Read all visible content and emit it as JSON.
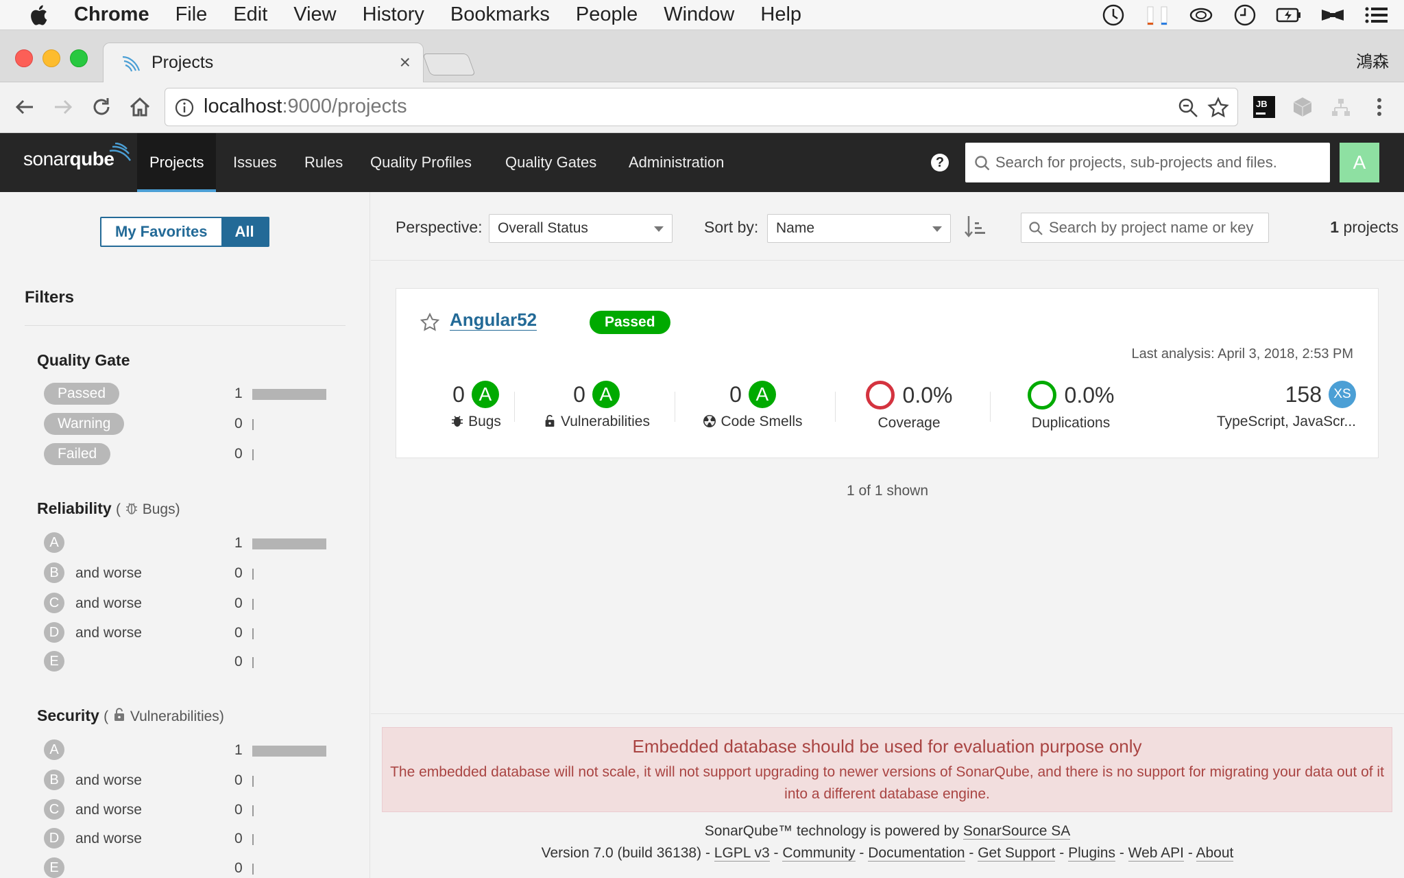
{
  "menubar": {
    "app": "Chrome",
    "items": [
      "File",
      "Edit",
      "View",
      "History",
      "Bookmarks",
      "People",
      "Window",
      "Help"
    ]
  },
  "browser": {
    "tab_title": "Projects",
    "tab_close": "×",
    "profile": "鴻森",
    "url_host": "localhost",
    "url_path": ":9000/projects"
  },
  "sq": {
    "logo_a": "sonar",
    "logo_b": "qube",
    "nav": [
      "Projects",
      "Issues",
      "Rules",
      "Quality Profiles",
      "Quality Gates",
      "Administration"
    ],
    "help": "?",
    "search_placeholder": "Search for projects, sub-projects and files.",
    "avatar": "A"
  },
  "sidebar": {
    "fav": "My Favorites",
    "all": "All",
    "filters": "Filters",
    "quality_gate": {
      "title": "Quality Gate",
      "items": [
        {
          "label": "Passed",
          "count": "1",
          "frac": 1
        },
        {
          "label": "Warning",
          "count": "0",
          "frac": 0
        },
        {
          "label": "Failed",
          "count": "0",
          "frac": 0
        }
      ]
    },
    "reliability": {
      "title": "Reliability",
      "open": "(",
      "sub": "Bugs",
      "close": ")"
    },
    "security": {
      "title": "Security",
      "open": "(",
      "sub": "Vulnerabilities",
      "close": ")"
    },
    "rating_rows": [
      {
        "grade": "A",
        "suffix": "",
        "count": "1",
        "frac": 1
      },
      {
        "grade": "B",
        "suffix": "and worse",
        "count": "0",
        "frac": 0
      },
      {
        "grade": "C",
        "suffix": "and worse",
        "count": "0",
        "frac": 0
      },
      {
        "grade": "D",
        "suffix": "and worse",
        "count": "0",
        "frac": 0
      },
      {
        "grade": "E",
        "suffix": "",
        "count": "0",
        "frac": 0
      }
    ]
  },
  "main": {
    "perspective_label": "Perspective:",
    "perspective_value": "Overall Status",
    "sort_label": "Sort by:",
    "sort_value": "Name",
    "search_placeholder": "Search by project name or key",
    "count": "1",
    "count_suffix": "projects",
    "shown": "1 of 1 shown"
  },
  "project": {
    "name": "Angular52",
    "gate": "Passed",
    "last_analysis": "Last analysis: April 3, 2018, 2:53 PM",
    "bugs": {
      "value": "0",
      "grade": "A",
      "label": "Bugs"
    },
    "vulns": {
      "value": "0",
      "grade": "A",
      "label": "Vulnerabilities"
    },
    "smells": {
      "value": "0",
      "grade": "A",
      "label": "Code Smells"
    },
    "coverage": {
      "value": "0.0%",
      "label": "Coverage",
      "color": "#d4333f"
    },
    "dups": {
      "value": "0.0%",
      "label": "Duplications",
      "color": "#00aa00"
    },
    "size": {
      "value": "158",
      "badge": "XS",
      "label": "TypeScript, JavaScr..."
    }
  },
  "warning": {
    "title": "Embedded database should be used for evaluation purpose only",
    "body": "The embedded database will not scale, it will not support upgrading to newer versions of SonarQube, and there is no support for migrating your data out of it into a different database engine."
  },
  "footer": {
    "powered": "SonarQube™ technology is powered by ",
    "company": "SonarSource SA",
    "version": "Version 7.0 (build 36138)",
    "sep": " - ",
    "links": [
      "LGPL v3",
      "Community",
      "Documentation",
      "Get Support",
      "Plugins",
      "Web API",
      "About"
    ]
  },
  "colors": {
    "passed": "#00aa00",
    "accent": "#236a97",
    "nav_bg": "#262626"
  }
}
